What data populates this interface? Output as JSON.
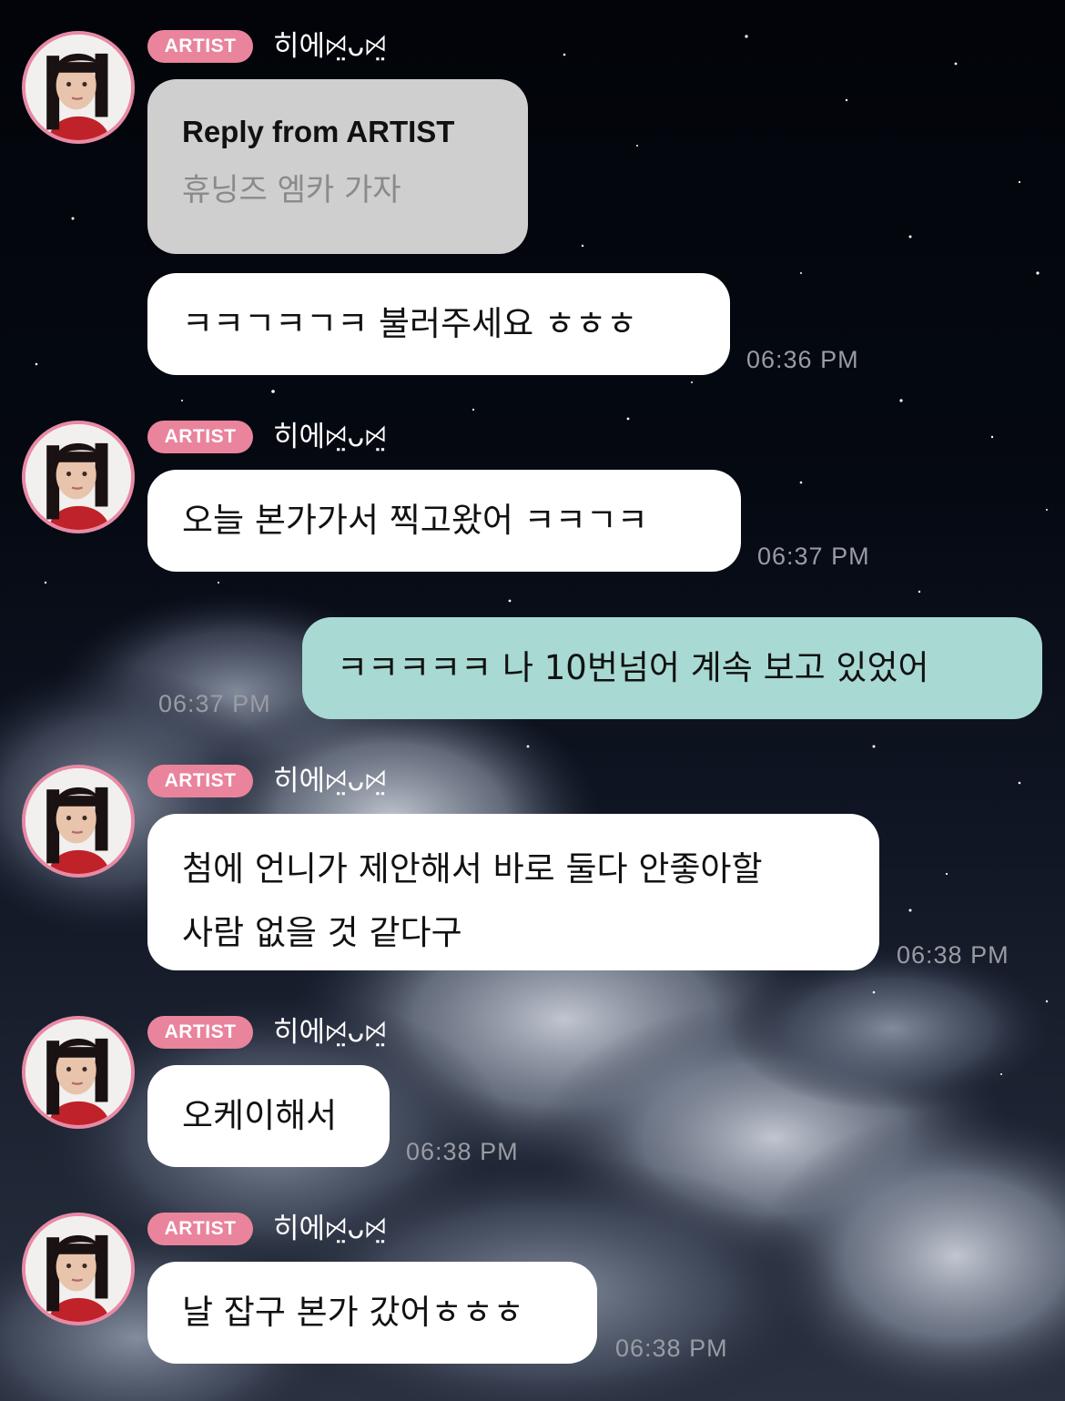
{
  "theme": {
    "badge_color": "#e9849c",
    "avatar_ring_color": "#e88aa5",
    "artist_bubble_color": "#ffffff",
    "fan_bubble_color": "#a8d9d3",
    "reply_bubble_color": "#cfcfcf"
  },
  "sender": {
    "badge": "ARTIST",
    "name": "히에ꗯ̤ᴗꗯ̤"
  },
  "messages": [
    {
      "from": "artist",
      "reply_title": "Reply from ARTIST",
      "reply_quote": "휴닝즈 엠카 가자",
      "text": "ㅋㅋㄱㅋㄱㅋ 불러주세요 ㅎㅎㅎ",
      "time": "06:36 PM"
    },
    {
      "from": "artist",
      "text": "오늘 본가가서 찍고왔어 ㅋㅋㄱㅋ",
      "time": "06:37 PM"
    },
    {
      "from": "me",
      "text": "ㅋㅋㅋㅋㅋ 나 10번넘어 계속 보고 있었어",
      "time": "06:37 PM"
    },
    {
      "from": "artist",
      "lines": [
        "첨에 언니가 제안해서 바로 둘다 안좋아할",
        "사람 없을 것 같다구"
      ],
      "time": "06:38 PM"
    },
    {
      "from": "artist",
      "text": "오케이해서",
      "time": "06:38 PM"
    },
    {
      "from": "artist",
      "text": "날 잡구 본가 갔어ㅎㅎㅎ",
      "time": "06:38 PM"
    }
  ]
}
